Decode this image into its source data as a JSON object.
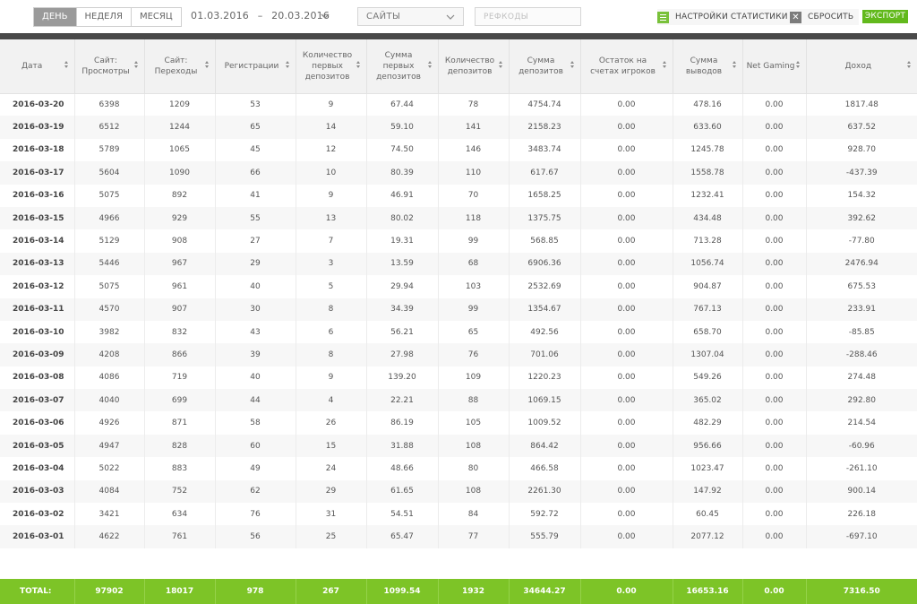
{
  "toolbar": {
    "period_buttons": [
      "ДЕНЬ",
      "НЕДЕЛЯ",
      "МЕСЯЦ"
    ],
    "active_period": "ДЕНЬ",
    "date_from": "01.03.2016",
    "date_to": "20.03.2016",
    "date_separator": "–",
    "sites_label": "САЙТЫ",
    "refcode_placeholder": "РЕФКОДЫ",
    "settings_label": "НАСТРОЙКИ СТАТИСТИКИ",
    "reset_label": "СБРОСИТЬ",
    "export_label": "ЭКСПОРТ",
    "icons": {
      "settings": "list-icon",
      "reset": "close-icon",
      "date": "chevron-down-icon",
      "sites": "chevron-down-icon"
    }
  },
  "colors": {
    "accent_green": "#7dc427",
    "export_green": "#62b91c",
    "dark_bar": "#494949",
    "active_period_bg": "#9a9a9a"
  },
  "table": {
    "columns": [
      "Дата",
      "Сайт: Просмотры",
      "Сайт: Переходы",
      "Регистрации",
      "Количество первых депозитов",
      "Сумма первых депозитов",
      "Количество депозитов",
      "Сумма депозитов",
      "Остаток на счетах игроков",
      "Сумма выводов",
      "Net Gaming",
      "Доход"
    ],
    "rows": [
      [
        "2016-03-20",
        "6398",
        "1209",
        "53",
        "9",
        "67.44",
        "78",
        "4754.74",
        "0.00",
        "478.16",
        "0.00",
        "1817.48"
      ],
      [
        "2016-03-19",
        "6512",
        "1244",
        "65",
        "14",
        "59.10",
        "141",
        "2158.23",
        "0.00",
        "633.60",
        "0.00",
        "637.52"
      ],
      [
        "2016-03-18",
        "5789",
        "1065",
        "45",
        "12",
        "74.50",
        "146",
        "3483.74",
        "0.00",
        "1245.78",
        "0.00",
        "928.70"
      ],
      [
        "2016-03-17",
        "5604",
        "1090",
        "66",
        "10",
        "80.39",
        "110",
        "617.67",
        "0.00",
        "1558.78",
        "0.00",
        "-437.39"
      ],
      [
        "2016-03-16",
        "5075",
        "892",
        "41",
        "9",
        "46.91",
        "70",
        "1658.25",
        "0.00",
        "1232.41",
        "0.00",
        "154.32"
      ],
      [
        "2016-03-15",
        "4966",
        "929",
        "55",
        "13",
        "80.02",
        "118",
        "1375.75",
        "0.00",
        "434.48",
        "0.00",
        "392.62"
      ],
      [
        "2016-03-14",
        "5129",
        "908",
        "27",
        "7",
        "19.31",
        "99",
        "568.85",
        "0.00",
        "713.28",
        "0.00",
        "-77.80"
      ],
      [
        "2016-03-13",
        "5446",
        "967",
        "29",
        "3",
        "13.59",
        "68",
        "6906.36",
        "0.00",
        "1056.74",
        "0.00",
        "2476.94"
      ],
      [
        "2016-03-12",
        "5075",
        "961",
        "40",
        "5",
        "29.94",
        "103",
        "2532.69",
        "0.00",
        "904.87",
        "0.00",
        "675.53"
      ],
      [
        "2016-03-11",
        "4570",
        "907",
        "30",
        "8",
        "34.39",
        "99",
        "1354.67",
        "0.00",
        "767.13",
        "0.00",
        "233.91"
      ],
      [
        "2016-03-10",
        "3982",
        "832",
        "43",
        "6",
        "56.21",
        "65",
        "492.56",
        "0.00",
        "658.70",
        "0.00",
        "-85.85"
      ],
      [
        "2016-03-09",
        "4208",
        "866",
        "39",
        "8",
        "27.98",
        "76",
        "701.06",
        "0.00",
        "1307.04",
        "0.00",
        "-288.46"
      ],
      [
        "2016-03-08",
        "4086",
        "719",
        "40",
        "9",
        "139.20",
        "109",
        "1220.23",
        "0.00",
        "549.26",
        "0.00",
        "274.48"
      ],
      [
        "2016-03-07",
        "4040",
        "699",
        "44",
        "4",
        "22.21",
        "88",
        "1069.15",
        "0.00",
        "365.02",
        "0.00",
        "292.80"
      ],
      [
        "2016-03-06",
        "4926",
        "871",
        "58",
        "26",
        "86.19",
        "105",
        "1009.52",
        "0.00",
        "482.29",
        "0.00",
        "214.54"
      ],
      [
        "2016-03-05",
        "4947",
        "828",
        "60",
        "15",
        "31.88",
        "108",
        "864.42",
        "0.00",
        "956.66",
        "0.00",
        "-60.96"
      ],
      [
        "2016-03-04",
        "5022",
        "883",
        "49",
        "24",
        "48.66",
        "80",
        "466.58",
        "0.00",
        "1023.47",
        "0.00",
        "-261.10"
      ],
      [
        "2016-03-03",
        "4084",
        "752",
        "62",
        "29",
        "61.65",
        "108",
        "2261.30",
        "0.00",
        "147.92",
        "0.00",
        "900.14"
      ],
      [
        "2016-03-02",
        "3421",
        "634",
        "76",
        "31",
        "54.51",
        "84",
        "592.72",
        "0.00",
        "60.45",
        "0.00",
        "226.18"
      ],
      [
        "2016-03-01",
        "4622",
        "761",
        "56",
        "25",
        "65.47",
        "77",
        "555.79",
        "0.00",
        "2077.12",
        "0.00",
        "-697.10"
      ]
    ],
    "total": [
      "TOTAL:",
      "97902",
      "18017",
      "978",
      "267",
      "1099.54",
      "1932",
      "34644.27",
      "0.00",
      "16653.16",
      "0.00",
      "7316.50"
    ]
  }
}
